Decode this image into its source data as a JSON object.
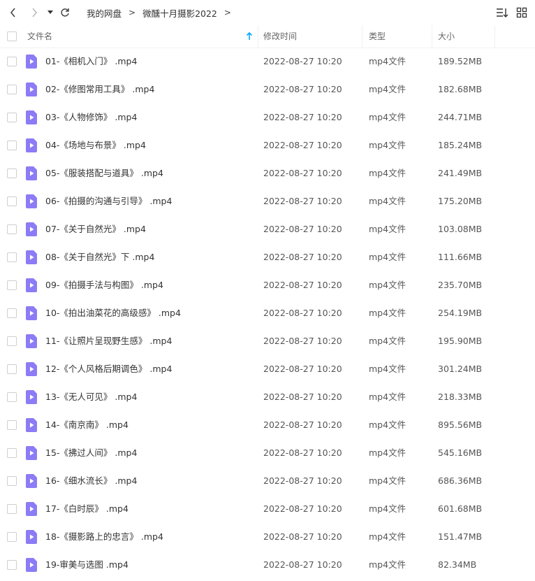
{
  "breadcrumb": {
    "root": "我的网盘",
    "separator": ">",
    "folder": "微醺十月摄影2022",
    "trailing_separator": ">"
  },
  "colors": {
    "accent": "#06a7ff",
    "file_icon": "#8b7cf6",
    "text": "#333333"
  },
  "icons": {
    "back": "chevron-left-icon",
    "forward": "chevron-right-icon",
    "dropdown": "caret-down-icon",
    "refresh": "refresh-icon",
    "sort": "sort-icon",
    "grid": "grid-view-icon",
    "file": "video-file-icon",
    "sort_indicator": "arrow-up-icon"
  },
  "columns": {
    "name": "文件名",
    "modified": "修改时间",
    "type": "类型",
    "size": "大小"
  },
  "sort": {
    "column": "name",
    "direction": "ascending"
  },
  "files": [
    {
      "name": "01-《相机入门》 .mp4",
      "modified": "2022-08-27 10:20",
      "type": "mp4文件",
      "size": "189.52MB"
    },
    {
      "name": "02-《修图常用工具》 .mp4",
      "modified": "2022-08-27 10:20",
      "type": "mp4文件",
      "size": "182.68MB"
    },
    {
      "name": "03-《人物修饰》 .mp4",
      "modified": "2022-08-27 10:20",
      "type": "mp4文件",
      "size": "244.71MB"
    },
    {
      "name": "04-《场地与布景》 .mp4",
      "modified": "2022-08-27 10:20",
      "type": "mp4文件",
      "size": "185.24MB"
    },
    {
      "name": "05-《服装搭配与道具》 .mp4",
      "modified": "2022-08-27 10:20",
      "type": "mp4文件",
      "size": "241.49MB"
    },
    {
      "name": "06-《拍摄的沟通与引导》 .mp4",
      "modified": "2022-08-27 10:20",
      "type": "mp4文件",
      "size": "175.20MB"
    },
    {
      "name": "07-《关于自然光》 .mp4",
      "modified": "2022-08-27 10:20",
      "type": "mp4文件",
      "size": "103.08MB"
    },
    {
      "name": "08-《关于自然光》下 .mp4",
      "modified": "2022-08-27 10:20",
      "type": "mp4文件",
      "size": "111.66MB"
    },
    {
      "name": "09-《拍摄手法与构图》 .mp4",
      "modified": "2022-08-27 10:20",
      "type": "mp4文件",
      "size": "235.70MB"
    },
    {
      "name": "10-《拍出油菜花的高级感》 .mp4",
      "modified": "2022-08-27 10:20",
      "type": "mp4文件",
      "size": "254.19MB"
    },
    {
      "name": "11-《让照片呈现野生感》 .mp4",
      "modified": "2022-08-27 10:20",
      "type": "mp4文件",
      "size": "195.90MB"
    },
    {
      "name": "12-《个人风格后期调色》 .mp4",
      "modified": "2022-08-27 10:20",
      "type": "mp4文件",
      "size": "301.24MB"
    },
    {
      "name": "13-《无人可见》 .mp4",
      "modified": "2022-08-27 10:20",
      "type": "mp4文件",
      "size": "218.33MB"
    },
    {
      "name": "14-《南京南》 .mp4",
      "modified": "2022-08-27 10:20",
      "type": "mp4文件",
      "size": "895.56MB"
    },
    {
      "name": "15-《拂过人间》 .mp4",
      "modified": "2022-08-27 10:20",
      "type": "mp4文件",
      "size": "545.16MB"
    },
    {
      "name": "16-《细水流长》 .mp4",
      "modified": "2022-08-27 10:20",
      "type": "mp4文件",
      "size": "686.36MB"
    },
    {
      "name": "17-《白时辰》 .mp4",
      "modified": "2022-08-27 10:20",
      "type": "mp4文件",
      "size": "601.68MB"
    },
    {
      "name": "18-《摄影路上的忠言》 .mp4",
      "modified": "2022-08-27 10:20",
      "type": "mp4文件",
      "size": "151.47MB"
    },
    {
      "name": "19-审美与选图 .mp4",
      "modified": "2022-08-27 10:20",
      "type": "mp4文件",
      "size": "82.34MB"
    }
  ]
}
